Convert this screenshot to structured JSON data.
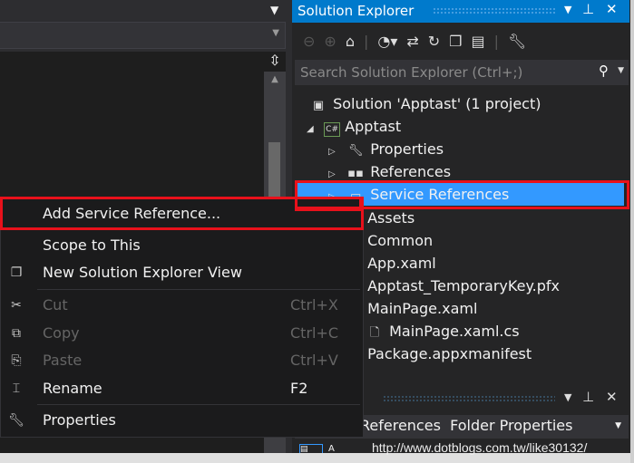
{
  "solution_explorer": {
    "title": "Solution Explorer",
    "search_placeholder": "Search Solution Explorer (Ctrl+;)",
    "tree": [
      {
        "label": "Solution 'Apptast' (1 project)",
        "icon": "solution-icon"
      },
      {
        "label": "Apptast",
        "icon": "csharp-project-icon"
      },
      {
        "label": "Properties",
        "icon": "wrench-icon"
      },
      {
        "label": "References",
        "icon": "references-icon"
      },
      {
        "label": "Service References",
        "icon": "folder-icon",
        "selected": true
      },
      {
        "label": "Assets",
        "icon": "folder-icon"
      },
      {
        "label": "Common",
        "icon": "folder-icon"
      },
      {
        "label": "App.xaml",
        "icon": "xaml-file-icon"
      },
      {
        "label": "Apptast_TemporaryKey.pfx",
        "icon": "certificate-icon"
      },
      {
        "label": "MainPage.xaml",
        "icon": "xaml-file-icon"
      },
      {
        "label": "MainPage.xaml.cs",
        "icon": "cs-file-icon"
      },
      {
        "label": "Package.appxmanifest",
        "icon": "manifest-icon"
      }
    ]
  },
  "context_menu": {
    "items": [
      {
        "label": "Add Service Reference..."
      },
      {
        "label": "Scope to This"
      },
      {
        "label": "New Solution Explorer View",
        "icon": "new-view-icon"
      },
      {
        "label": "Cut",
        "shortcut": "Ctrl+X",
        "icon": "scissors-icon",
        "disabled": true
      },
      {
        "label": "Copy",
        "shortcut": "Ctrl+C",
        "icon": "copy-icon",
        "disabled": true
      },
      {
        "label": "Paste",
        "shortcut": "Ctrl+V",
        "icon": "paste-icon",
        "disabled": true
      },
      {
        "label": "Rename",
        "shortcut": "F2",
        "icon": "rename-icon"
      },
      {
        "label": "Properties",
        "icon": "wrench-icon"
      }
    ]
  },
  "properties": {
    "title_fragment": "s",
    "selected_object": "References  Folder Properties"
  },
  "watermark": "http://www.dotblogs.com.tw/like30132/",
  "colors": {
    "accent": "#007acc",
    "selection": "#3399ff",
    "highlight_box": "#e8111b"
  }
}
